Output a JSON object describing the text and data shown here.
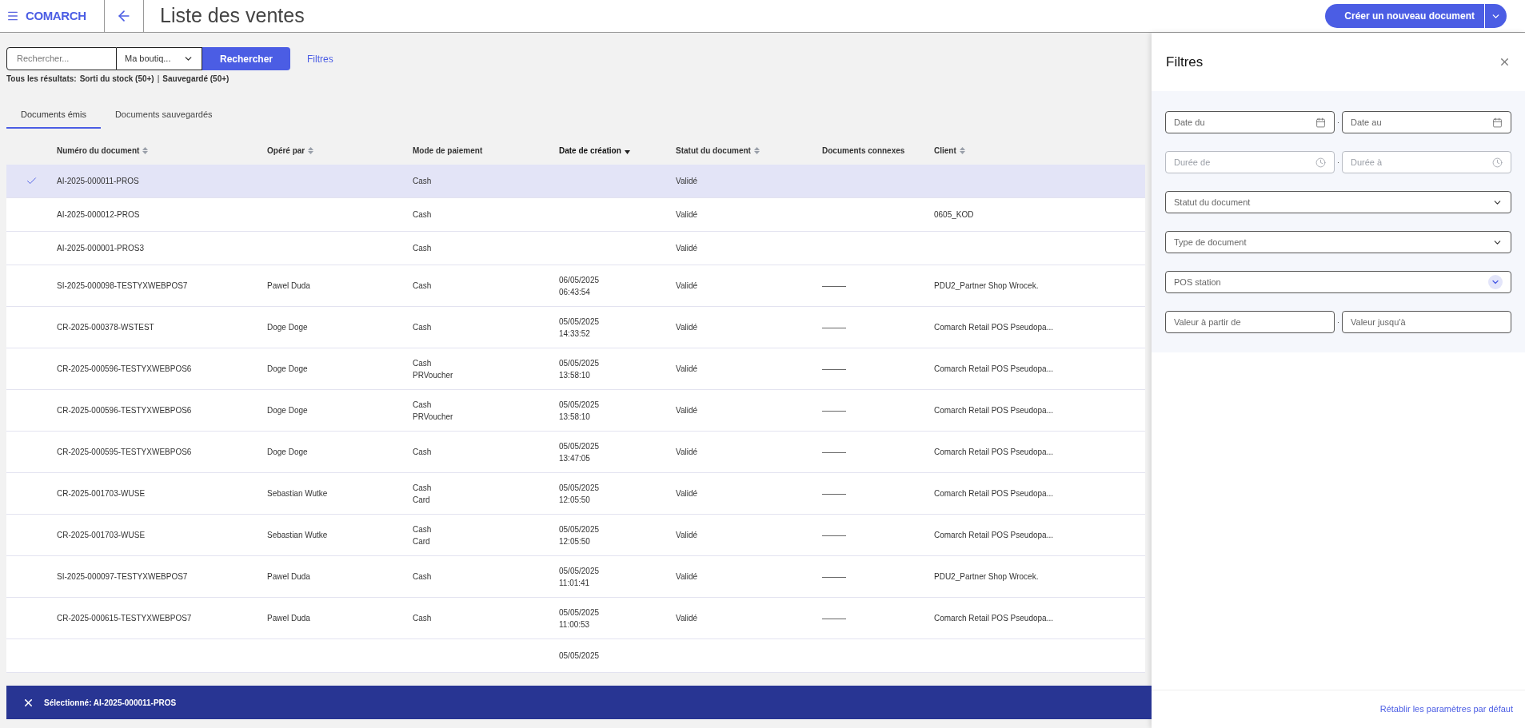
{
  "header": {
    "logo": "COMARCH",
    "title": "Liste des ventes",
    "create_button": "Créer un nouveau document"
  },
  "search": {
    "placeholder": "Rechercher...",
    "shop": "Ma boutiq...",
    "search_button": "Rechercher",
    "filters_link": "Filtres"
  },
  "results_summary": {
    "label": "Tous les résultats:",
    "stock": "Sorti du stock (50+)",
    "separator": "|",
    "saved": "Sauvegardé (50+)"
  },
  "tabs": [
    {
      "label": "Documents émis",
      "selected": true
    },
    {
      "label": "Documents sauvegardés",
      "selected": false
    }
  ],
  "table": {
    "columns": [
      {
        "label": "Numéro du document",
        "sortable": true,
        "sorted": false
      },
      {
        "label": "Opéré par",
        "sortable": true,
        "sorted": false
      },
      {
        "label": "Mode de paiement",
        "sortable": false,
        "sorted": false
      },
      {
        "label": "Date de création",
        "sortable": true,
        "sorted": true
      },
      {
        "label": "Statut du document",
        "sortable": true,
        "sorted": false
      },
      {
        "label": "Documents connexes",
        "sortable": false,
        "sorted": false
      },
      {
        "label": "Client",
        "sortable": true,
        "sorted": false
      }
    ],
    "rows": [
      {
        "selected": true,
        "cells": [
          [
            "AI-2025-000011-PROS"
          ],
          [],
          [
            "Cash"
          ],
          [],
          [
            "Validé"
          ],
          [],
          []
        ]
      },
      {
        "selected": false,
        "cells": [
          [
            "AI-2025-000012-PROS"
          ],
          [],
          [
            "Cash"
          ],
          [],
          [
            "Validé"
          ],
          [],
          [
            "0605_KOD"
          ]
        ]
      },
      {
        "selected": false,
        "cells": [
          [
            "AI-2025-000001-PROS3"
          ],
          [],
          [
            "Cash"
          ],
          [],
          [
            "Validé"
          ],
          [],
          []
        ]
      },
      {
        "selected": false,
        "cells": [
          [
            "SI-2025-000098-TESTYXWEBPOS7"
          ],
          [
            "Pawel Duda"
          ],
          [
            "Cash"
          ],
          [
            "06/05/2025",
            "06:43:54"
          ],
          [
            "Validé"
          ],
          [
            "———"
          ],
          [
            "PDU2_Partner Shop Wrocek."
          ]
        ]
      },
      {
        "selected": false,
        "cells": [
          [
            "CR-2025-000378-WSTEST"
          ],
          [
            "Doge Doge"
          ],
          [
            "Cash"
          ],
          [
            "05/05/2025",
            "14:33:52"
          ],
          [
            "Validé"
          ],
          [
            "———"
          ],
          [
            "Comarch Retail POS Pseudopa..."
          ]
        ]
      },
      {
        "selected": false,
        "cells": [
          [
            "CR-2025-000596-TESTYXWEBPOS6"
          ],
          [
            "Doge Doge"
          ],
          [
            "Cash",
            "PRVoucher"
          ],
          [
            "05/05/2025",
            "13:58:10"
          ],
          [
            "Validé"
          ],
          [
            "———"
          ],
          [
            "Comarch Retail POS Pseudopa..."
          ]
        ]
      },
      {
        "selected": false,
        "cells": [
          [
            "CR-2025-000596-TESTYXWEBPOS6"
          ],
          [
            "Doge Doge"
          ],
          [
            "Cash",
            "PRVoucher"
          ],
          [
            "05/05/2025",
            "13:58:10"
          ],
          [
            "Validé"
          ],
          [
            "———"
          ],
          [
            "Comarch Retail POS Pseudopa..."
          ]
        ]
      },
      {
        "selected": false,
        "cells": [
          [
            "CR-2025-000595-TESTYXWEBPOS6"
          ],
          [
            "Doge Doge"
          ],
          [
            "Cash"
          ],
          [
            "05/05/2025",
            "13:47:05"
          ],
          [
            "Validé"
          ],
          [
            "———"
          ],
          [
            "Comarch Retail POS Pseudopa..."
          ]
        ]
      },
      {
        "selected": false,
        "cells": [
          [
            "CR-2025-001703-WUSE"
          ],
          [
            "Sebastian Wutke"
          ],
          [
            "Cash",
            "Card"
          ],
          [
            "05/05/2025",
            "12:05:50"
          ],
          [
            "Validé"
          ],
          [
            "———"
          ],
          [
            "Comarch Retail POS Pseudopa..."
          ]
        ]
      },
      {
        "selected": false,
        "cells": [
          [
            "CR-2025-001703-WUSE"
          ],
          [
            "Sebastian Wutke"
          ],
          [
            "Cash",
            "Card"
          ],
          [
            "05/05/2025",
            "12:05:50"
          ],
          [
            "Validé"
          ],
          [
            "———"
          ],
          [
            "Comarch Retail POS Pseudopa..."
          ]
        ]
      },
      {
        "selected": false,
        "cells": [
          [
            "SI-2025-000097-TESTYXWEBPOS7"
          ],
          [
            "Pawel Duda"
          ],
          [
            "Cash"
          ],
          [
            "05/05/2025",
            "11:01:41"
          ],
          [
            "Validé"
          ],
          [
            "———"
          ],
          [
            "PDU2_Partner Shop Wrocek."
          ]
        ]
      },
      {
        "selected": false,
        "cells": [
          [
            "CR-2025-000615-TESTYXWEBPOS7"
          ],
          [
            "Pawel Duda"
          ],
          [
            "Cash"
          ],
          [
            "05/05/2025",
            "11:00:53"
          ],
          [
            "Validé"
          ],
          [
            "———"
          ],
          [
            "Comarch Retail POS Pseudopa..."
          ]
        ]
      },
      {
        "selected": false,
        "cells": [
          [],
          [],
          [],
          [
            "05/05/2025"
          ],
          [],
          [],
          []
        ]
      }
    ]
  },
  "selection_bar": {
    "text": "Sélectionné: AI-2025-000011-PROS"
  },
  "filters": {
    "title": "Filtres",
    "fields": [
      {
        "kind": "pair",
        "disabled": false,
        "items": [
          "Date du",
          "Date au"
        ]
      },
      {
        "kind": "pair",
        "disabled": true,
        "items": [
          "Durée de",
          "Durée à"
        ]
      },
      {
        "kind": "select",
        "placeholder": "Statut du document"
      },
      {
        "kind": "select",
        "placeholder": "Type de document"
      },
      {
        "kind": "select",
        "placeholder": "POS station"
      },
      {
        "kind": "pair",
        "disabled": false,
        "items": [
          "Valeur à partir de",
          "Valeur jusqu'à"
        ]
      }
    ],
    "reset_link": "Rétablir les paramètres par défaut"
  }
}
